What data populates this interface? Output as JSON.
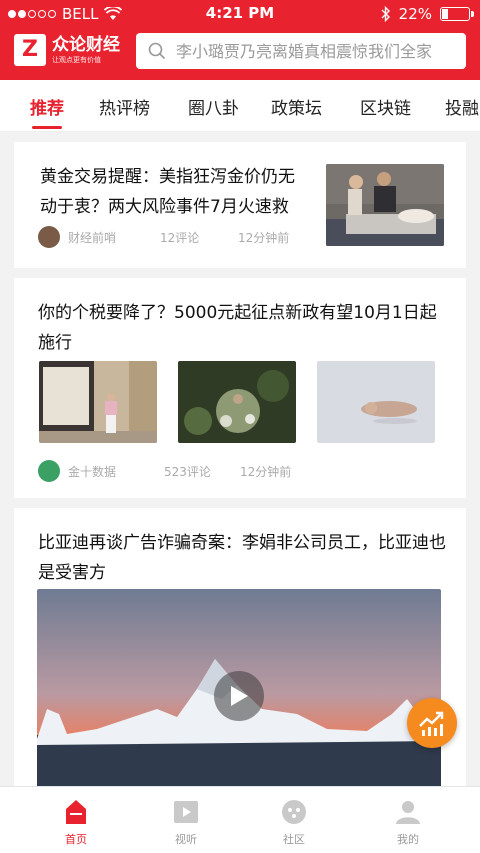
{
  "status_bar": {
    "carrier": "BELL",
    "time": "4:21 PM",
    "battery": "22%",
    "battery_level": 0.22
  },
  "app": {
    "logo_letter": "Z",
    "name": "众论财经",
    "slogan": "让观点更有价值"
  },
  "search": {
    "placeholder": "李小璐贾乃亮离婚真相震惊我们全家"
  },
  "tabs": [
    "推荐",
    "热评榜",
    "圈八卦",
    "政策坛",
    "区块链",
    "投融"
  ],
  "articles": [
    {
      "title": "黄金交易提醒：美指狂泻金价仍无动于衷？两大风险事件7月火速救",
      "source": "财经前哨",
      "comments": "12评论",
      "time": "12分钟前"
    },
    {
      "title": "你的个税要降了？5000元起征点新政有望10月1日起施行",
      "source": "金十数据",
      "comments": "523评论",
      "time": "12分钟前"
    },
    {
      "title": "比亚迪再谈广告诈骗奇案：李娟非公司员工，比亚迪也是受害方"
    }
  ],
  "tabbar": [
    {
      "label": "首页",
      "icon": "home-icon"
    },
    {
      "label": "视听",
      "icon": "video-icon"
    },
    {
      "label": "社区",
      "icon": "community-icon"
    },
    {
      "label": "我的",
      "icon": "profile-icon"
    }
  ],
  "colors": {
    "brand": "#e8232f",
    "fab": "#f58a1f"
  }
}
